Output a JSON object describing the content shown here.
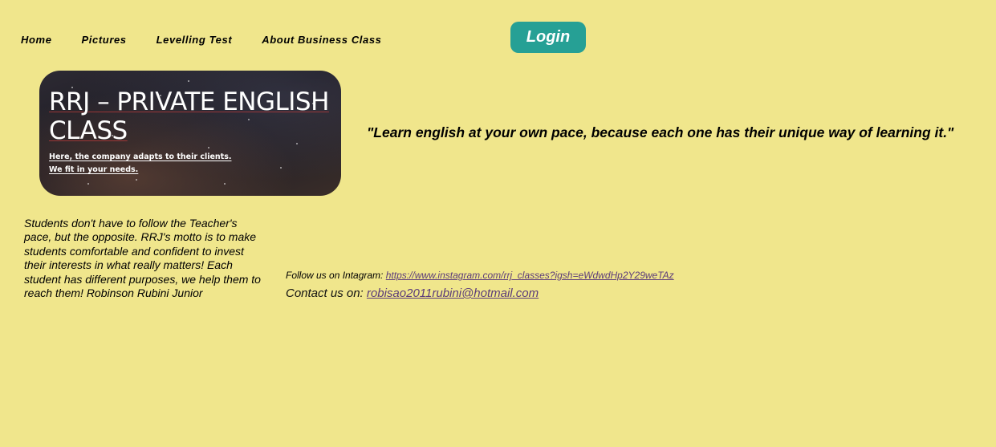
{
  "nav": {
    "items": [
      {
        "label": "Home"
      },
      {
        "label": "Pictures"
      },
      {
        "label": "Levelling Test"
      },
      {
        "label": "About Business Class"
      }
    ],
    "login_label": "Login"
  },
  "banner": {
    "title_line1": "RRJ – PRIVATE ENGLISH",
    "title_line2": "CLASS",
    "subtitle_line1": "Here, the company adapts to their clients.",
    "subtitle_line2": "We fit in your needs."
  },
  "quote": "\"Learn english at your own pace, because each one has their unique way of learning it.\"",
  "description": "Students don't have to follow the Teacher's pace, but the opposite. RRJ's motto is to make students comfortable and confident to invest their interests in what really matters! Each student has different purposes, we help them to reach them! Robinson Rubini Junior",
  "social": {
    "follow_label": "Follow us on Intagram: ",
    "instagram_link": "https://www.instagram.com/rrj_classes?igsh=eWdwdHp2Y29weTAz",
    "contact_label": "Contact us on: ",
    "email_link": "robisao2011rubini@hotmail.com"
  },
  "colors": {
    "background": "#f0e68c",
    "login_button": "#26a095",
    "link": "#5b3b7a"
  }
}
